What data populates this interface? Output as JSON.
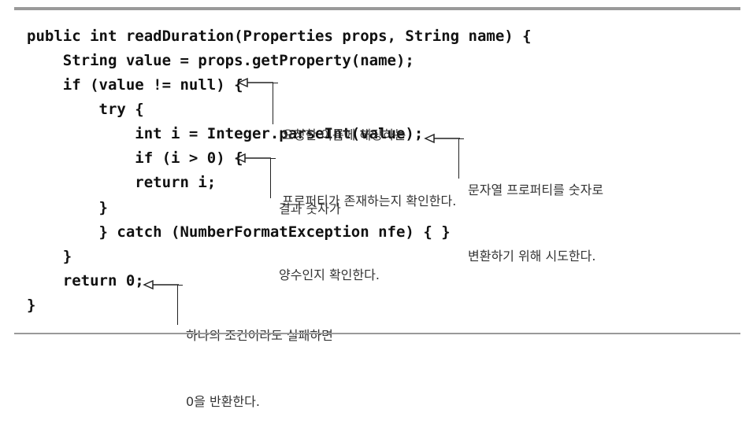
{
  "code": {
    "lines": [
      "public int readDuration(Properties props, String name) {",
      "    String value = props.getProperty(name);",
      "    if (value != null) {",
      "        try {",
      "            int i = Integer.parseInt(value);",
      "            if (i > 0) {",
      "            return i;",
      "        }",
      "        } catch (NumberFormatException nfe) { }",
      "    }",
      "    return 0;",
      "}"
    ]
  },
  "annotations": [
    {
      "lines": [
        "요청한 이름에 해당하는",
        "프로퍼티가 존재하는지 확인한다."
      ]
    },
    {
      "lines": [
        "문자열 프로퍼티를 숫자로",
        "변환하기 위해 시도한다."
      ]
    },
    {
      "lines": [
        "결과 숫자가",
        "양수인지 확인한다."
      ]
    },
    {
      "lines": [
        "하나의 조건이라도 실패하면",
        "0을 반환한다."
      ]
    }
  ]
}
